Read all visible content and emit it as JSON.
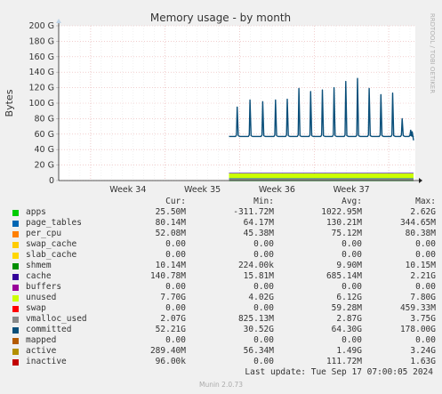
{
  "chart_data": {
    "type": "area",
    "title": "Memory usage - by month",
    "ylabel": "Bytes",
    "ylim": [
      0,
      200
    ],
    "y_unit": "G",
    "y_ticks": [
      "0",
      "20 G",
      "40 G",
      "60 G",
      "80 G",
      "100 G",
      "120 G",
      "140 G",
      "160 G",
      "180 G",
      "200 G"
    ],
    "x_ticks": [
      "Week 34",
      "Week 35",
      "Week 36",
      "Week 37"
    ],
    "x_start_day": 0,
    "x_end_day": 32,
    "data_start_day": 16,
    "grid": true,
    "side_label": "RRDTOOL / TOBI OETIKER",
    "stacked_bands": [
      {
        "name": "apps",
        "color": "#00cc00",
        "gb": 0.03
      },
      {
        "name": "vmalloc_used",
        "color": "#888888",
        "gb": 2.9
      },
      {
        "name": "page_tables",
        "color": "#0066b3",
        "gb": 0.13
      },
      {
        "name": "unused",
        "color": "#ccff00",
        "gb": 6.1
      },
      {
        "name": "cache",
        "color": "#330099",
        "gb": 0.7
      }
    ],
    "committed_series": {
      "name": "committed",
      "color": "#0a4f7a",
      "baseline": 57,
      "spikes": [
        {
          "day": 16.8,
          "value": 95
        },
        {
          "day": 18.0,
          "value": 104
        },
        {
          "day": 19.2,
          "value": 102
        },
        {
          "day": 20.4,
          "value": 104
        },
        {
          "day": 21.5,
          "value": 105
        },
        {
          "day": 22.6,
          "value": 119
        },
        {
          "day": 23.7,
          "value": 115
        },
        {
          "day": 24.8,
          "value": 117
        },
        {
          "day": 25.9,
          "value": 120
        },
        {
          "day": 27.0,
          "value": 128
        },
        {
          "day": 28.1,
          "value": 132
        },
        {
          "day": 29.2,
          "value": 119
        },
        {
          "day": 30.3,
          "value": 111
        },
        {
          "day": 31.4,
          "value": 113
        },
        {
          "day": 32.3,
          "value": 80
        },
        {
          "day": 33.1,
          "value": 65
        }
      ]
    }
  },
  "legend": {
    "headers": {
      "cur": "Cur:",
      "min": "Min:",
      "avg": "Avg:",
      "max": "Max:"
    },
    "rows": [
      {
        "name": "apps",
        "color": "#00cc00",
        "cur": "25.50M",
        "min": "-311.72M",
        "avg": "1022.95M",
        "max": "2.62G"
      },
      {
        "name": "page_tables",
        "color": "#0066b3",
        "cur": "80.14M",
        "min": "64.17M",
        "avg": "130.21M",
        "max": "344.65M"
      },
      {
        "name": "per_cpu",
        "color": "#ff8000",
        "cur": "52.08M",
        "min": "45.38M",
        "avg": "75.12M",
        "max": "80.38M"
      },
      {
        "name": "swap_cache",
        "color": "#ffcc00",
        "cur": "0.00",
        "min": "0.00",
        "avg": "0.00",
        "max": "0.00"
      },
      {
        "name": "slab_cache",
        "color": "#ffd700",
        "cur": "0.00",
        "min": "0.00",
        "avg": "0.00",
        "max": "0.00"
      },
      {
        "name": "shmem",
        "color": "#008f00",
        "cur": "10.14M",
        "min": "224.00k",
        "avg": "9.90M",
        "max": "10.15M"
      },
      {
        "name": "cache",
        "color": "#330099",
        "cur": "140.78M",
        "min": "15.81M",
        "avg": "685.14M",
        "max": "2.21G"
      },
      {
        "name": "buffers",
        "color": "#990099",
        "cur": "0.00",
        "min": "0.00",
        "avg": "0.00",
        "max": "0.00"
      },
      {
        "name": "unused",
        "color": "#ccff00",
        "cur": "7.70G",
        "min": "4.02G",
        "avg": "6.12G",
        "max": "7.80G"
      },
      {
        "name": "swap",
        "color": "#ff0000",
        "cur": "0.00",
        "min": "0.00",
        "avg": "59.28M",
        "max": "459.33M"
      },
      {
        "name": "vmalloc_used",
        "color": "#888888",
        "cur": "2.07G",
        "min": "825.13M",
        "avg": "2.87G",
        "max": "3.75G"
      },
      {
        "name": "committed",
        "color": "#0a4f7a",
        "cur": "52.21G",
        "min": "30.52G",
        "avg": "64.30G",
        "max": "178.00G"
      },
      {
        "name": "mapped",
        "color": "#b35a00",
        "cur": "0.00",
        "min": "0.00",
        "avg": "0.00",
        "max": "0.00"
      },
      {
        "name": "active",
        "color": "#b38f00",
        "cur": "289.40M",
        "min": "56.34M",
        "avg": "1.49G",
        "max": "3.24G"
      },
      {
        "name": "inactive",
        "color": "#c20000",
        "cur": "96.00k",
        "min": "0.00",
        "avg": "111.72M",
        "max": "1.63G"
      }
    ]
  },
  "footer": {
    "last_update": "Last update: Tue Sep 17 07:00:05 2024",
    "version": "Munin 2.0.73"
  }
}
